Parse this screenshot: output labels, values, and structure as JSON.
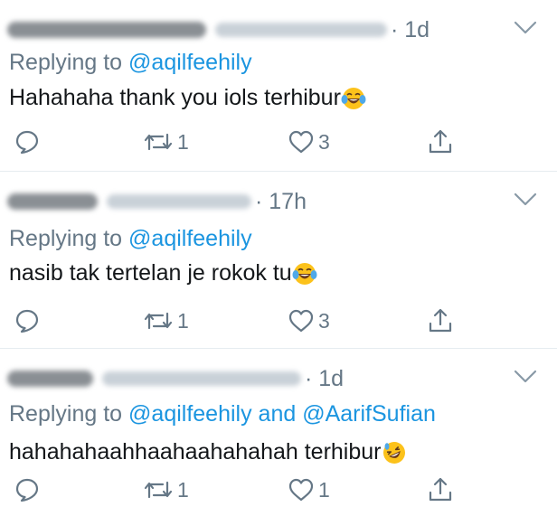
{
  "tweets": [
    {
      "time": "· 1d",
      "replying_prefix": "Replying to ",
      "mentions": [
        "@aqilfeehily"
      ],
      "joiner": "",
      "text": "Hahahaha thank you iols terhibur",
      "emoji": "face-with-tears-of-joy",
      "reply_count": "",
      "retweet_count": "1",
      "like_count": "3"
    },
    {
      "time": "· 17h",
      "replying_prefix": "Replying to ",
      "mentions": [
        "@aqilfeehily"
      ],
      "joiner": "",
      "text": "nasib tak tertelan je rokok tu",
      "emoji": "face-with-tears-of-joy",
      "reply_count": "",
      "retweet_count": "1",
      "like_count": "3"
    },
    {
      "time": "· 1d",
      "replying_prefix": "Replying to ",
      "mentions": [
        "@aqilfeehily",
        "@AarifSufian"
      ],
      "joiner": " and ",
      "text": "hahahahaahhaahaahahahah terhibur ",
      "emoji": "rolling-on-the-floor-laughing",
      "reply_count": "",
      "retweet_count": "1",
      "like_count": "1"
    }
  ],
  "icons": {
    "reply": "reply-icon",
    "retweet": "retweet-icon",
    "like": "heart-icon",
    "share": "share-icon",
    "menu": "chevron-down-icon"
  },
  "colors": {
    "text": "#14171a",
    "muted": "#657786",
    "link": "#1b95e0",
    "divider": "#e6ecf0",
    "emoji_face": "#fcc21b"
  }
}
